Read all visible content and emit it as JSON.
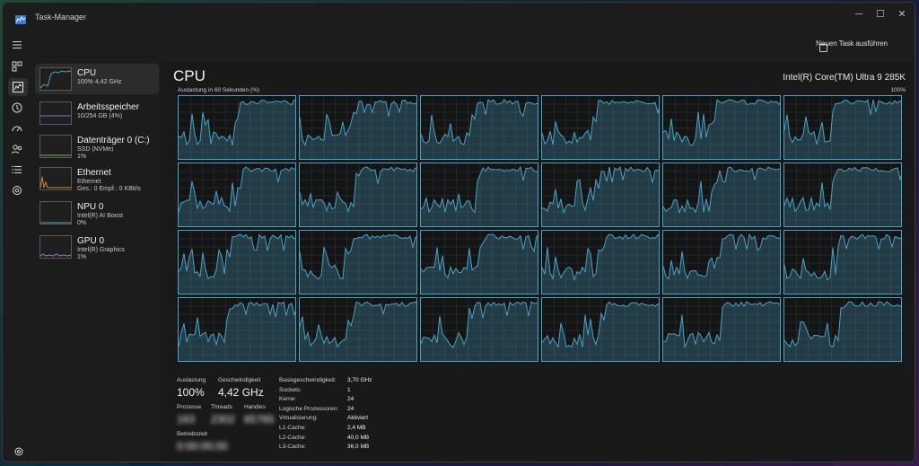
{
  "window": {
    "title": "Task-Manager"
  },
  "toolbar": {
    "run_task_label": "Neuen Task ausführen"
  },
  "nav": {
    "items": [
      "menu-icon",
      "processes-icon",
      "performance-icon",
      "history-icon",
      "startup-icon",
      "users-icon",
      "details-icon",
      "services-icon"
    ],
    "settings_icon": "settings-icon"
  },
  "sidebar": {
    "items": [
      {
        "name": "CPU",
        "sub1": "100% 4,42 GHz",
        "sub2": "",
        "color": "#4aa3c7"
      },
      {
        "name": "Arbeitsspeicher",
        "sub1": "10/254 GB (4%)",
        "sub2": "",
        "color": "#8a6fcf"
      },
      {
        "name": "Datenträger 0 (C:)",
        "sub1": "SSD (NVMe)",
        "sub2": "1%",
        "color": "#6fbf5a"
      },
      {
        "name": "Ethernet",
        "sub1": "Ethernet",
        "sub2": "Ges.: 0 Empf.: 0 KBit/s",
        "color": "#d08a3a"
      },
      {
        "name": "NPU 0",
        "sub1": "Intel(R) AI Boost",
        "sub2": "0%",
        "color": "#4aa3c7"
      },
      {
        "name": "GPU 0",
        "sub1": "Intel(R) Graphics",
        "sub2": "1%",
        "color": "#b06fcf"
      }
    ]
  },
  "main": {
    "title": "CPU",
    "model": "Intel(R) Core(TM) Ultra 9 285K",
    "graph_left_label": "Auslastung in 60 Sekunden (%)",
    "graph_right_label": "100%",
    "accent": "#4aa3c7",
    "core_count": 24
  },
  "stats": {
    "utilization_label": "Auslastung",
    "utilization_value": "100%",
    "speed_label": "Geschwindigkeit",
    "speed_value": "4,42 GHz",
    "processes_label": "Prozesse",
    "processes_value": "163",
    "threads_label": "Threads",
    "threads_value": "2302",
    "handles_label": "Handles",
    "handles_value": "65765",
    "uptime_label": "Betriebszeit",
    "uptime_value": "0:00:00:00"
  },
  "specs": [
    {
      "label": "Basisgeschwindigkeit:",
      "value": "3,70 GHz"
    },
    {
      "label": "Sockets:",
      "value": "1"
    },
    {
      "label": "Kerne:",
      "value": "24"
    },
    {
      "label": "Logische Prozessoren:",
      "value": "24"
    },
    {
      "label": "Virtualisierung:",
      "value": "Aktiviert"
    },
    {
      "label": "L1-Cache:",
      "value": "2,4 MB"
    },
    {
      "label": "L2-Cache:",
      "value": "40,0 MB"
    },
    {
      "label": "L3-Cache:",
      "value": "36,0 MB"
    }
  ]
}
